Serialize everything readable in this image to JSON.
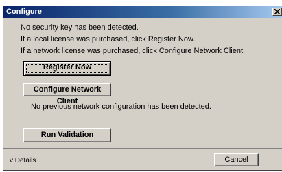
{
  "window": {
    "title": "Configure",
    "close_glyph": "×"
  },
  "messages": {
    "line1": "No security key has been detected.",
    "line2": "If a local license was purchased, click Register Now.",
    "line3": "If a network license was purchased, click Configure Network Client.",
    "network_status": "No previous network configuration has been detected."
  },
  "buttons": {
    "register_now": "Register Now",
    "configure_network_client": "Configure Network Client",
    "run_validation": "Run Validation",
    "cancel": "Cancel"
  },
  "footer": {
    "details_label": "v Details"
  },
  "icons": {
    "close": "close-icon"
  },
  "colors": {
    "titlebar_start": "#0a246a",
    "titlebar_end": "#a6caf0",
    "dialog_face": "#d4d0c8"
  }
}
